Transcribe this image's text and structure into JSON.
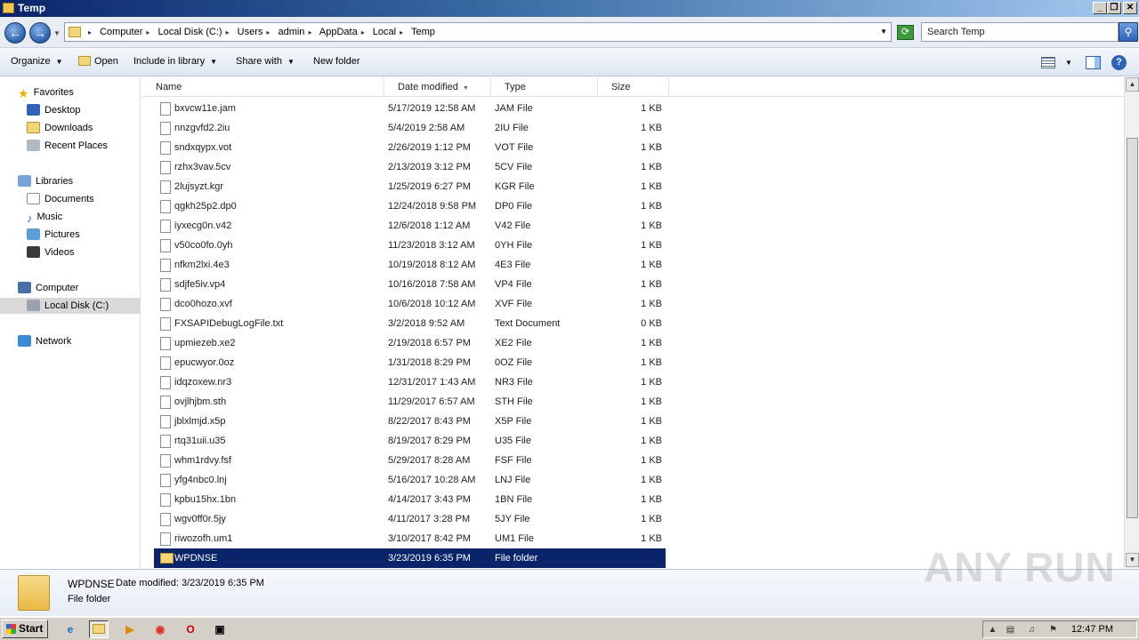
{
  "window": {
    "title": "Temp",
    "minimize": "_",
    "maximize": "❐",
    "close": "✕"
  },
  "address": {
    "back": "←",
    "forward": "→",
    "crumbs": [
      "Computer",
      "Local Disk (C:)",
      "Users",
      "admin",
      "AppData",
      "Local",
      "Temp"
    ],
    "search_placeholder": "Search Temp"
  },
  "toolbar": {
    "organize": "Organize",
    "open": "Open",
    "include_in_library": "Include in library",
    "share_with": "Share with",
    "new_folder": "New folder"
  },
  "nav": {
    "favorites": "Favorites",
    "desktop": "Desktop",
    "downloads": "Downloads",
    "recent_places": "Recent Places",
    "libraries": "Libraries",
    "documents": "Documents",
    "music": "Music",
    "pictures": "Pictures",
    "videos": "Videos",
    "computer": "Computer",
    "local_disk": "Local Disk (C:)",
    "network": "Network"
  },
  "columns": {
    "name": "Name",
    "date_modified": "Date modified",
    "type": "Type",
    "size": "Size"
  },
  "files": [
    {
      "name": "bxvcw11e.jam",
      "date": "5/17/2019 12:58 AM",
      "type": "JAM File",
      "size": "1 KB"
    },
    {
      "name": "nnzgvfd2.2iu",
      "date": "5/4/2019 2:58 AM",
      "type": "2IU File",
      "size": "1 KB"
    },
    {
      "name": "sndxqypx.vot",
      "date": "2/26/2019 1:12 PM",
      "type": "VOT File",
      "size": "1 KB"
    },
    {
      "name": "rzhx3vav.5cv",
      "date": "2/13/2019 3:12 PM",
      "type": "5CV File",
      "size": "1 KB"
    },
    {
      "name": "2lujsyzt.kgr",
      "date": "1/25/2019 6:27 PM",
      "type": "KGR File",
      "size": "1 KB"
    },
    {
      "name": "qgkh25p2.dp0",
      "date": "12/24/2018 9:58 PM",
      "type": "DP0 File",
      "size": "1 KB"
    },
    {
      "name": "iyxecg0n.v42",
      "date": "12/6/2018 1:12 AM",
      "type": "V42 File",
      "size": "1 KB"
    },
    {
      "name": "v50co0fo.0yh",
      "date": "11/23/2018 3:12 AM",
      "type": "0YH File",
      "size": "1 KB"
    },
    {
      "name": "nfkm2lxi.4e3",
      "date": "10/19/2018 8:12 AM",
      "type": "4E3 File",
      "size": "1 KB"
    },
    {
      "name": "sdjfe5iv.vp4",
      "date": "10/16/2018 7:58 AM",
      "type": "VP4 File",
      "size": "1 KB"
    },
    {
      "name": "dco0hozo.xvf",
      "date": "10/6/2018 10:12 AM",
      "type": "XVF File",
      "size": "1 KB"
    },
    {
      "name": "FXSAPIDebugLogFile.txt",
      "date": "3/2/2018 9:52 AM",
      "type": "Text Document",
      "size": "0 KB"
    },
    {
      "name": "upmiezeb.xe2",
      "date": "2/19/2018 6:57 PM",
      "type": "XE2 File",
      "size": "1 KB"
    },
    {
      "name": "epucwyor.0oz",
      "date": "1/31/2018 8:29 PM",
      "type": "0OZ File",
      "size": "1 KB"
    },
    {
      "name": "idqzoxew.nr3",
      "date": "12/31/2017 1:43 AM",
      "type": "NR3 File",
      "size": "1 KB"
    },
    {
      "name": "ovjlhjbm.sth",
      "date": "11/29/2017 6:57 AM",
      "type": "STH File",
      "size": "1 KB"
    },
    {
      "name": "jblxlmjd.x5p",
      "date": "8/22/2017 8:43 PM",
      "type": "X5P File",
      "size": "1 KB"
    },
    {
      "name": "rtq31uii.u35",
      "date": "8/19/2017 8:29 PM",
      "type": "U35 File",
      "size": "1 KB"
    },
    {
      "name": "whm1rdvy.fsf",
      "date": "5/29/2017 8:28 AM",
      "type": "FSF File",
      "size": "1 KB"
    },
    {
      "name": "yfg4nbc0.lnj",
      "date": "5/16/2017 10:28 AM",
      "type": "LNJ File",
      "size": "1 KB"
    },
    {
      "name": "kpbu15hx.1bn",
      "date": "4/14/2017 3:43 PM",
      "type": "1BN File",
      "size": "1 KB"
    },
    {
      "name": "wgv0ff0r.5jy",
      "date": "4/11/2017 3:28 PM",
      "type": "5JY File",
      "size": "1 KB"
    },
    {
      "name": "riwozofh.um1",
      "date": "3/10/2017 8:42 PM",
      "type": "UM1 File",
      "size": "1 KB"
    },
    {
      "name": "WPDNSE",
      "date": "3/23/2019 6:35 PM",
      "type": "File folder",
      "size": "",
      "folder": true,
      "selected": true
    }
  ],
  "details": {
    "name": "WPDNSE",
    "meta": "Date modified: 3/23/2019 6:35 PM",
    "type": "File folder",
    "watermark": "ANY RUN"
  },
  "taskbar": {
    "start": "Start",
    "clock": "12:47 PM"
  },
  "colors": {
    "selection": "#0a246a",
    "title_start": "#0a246a",
    "title_end": "#a6caf0"
  }
}
